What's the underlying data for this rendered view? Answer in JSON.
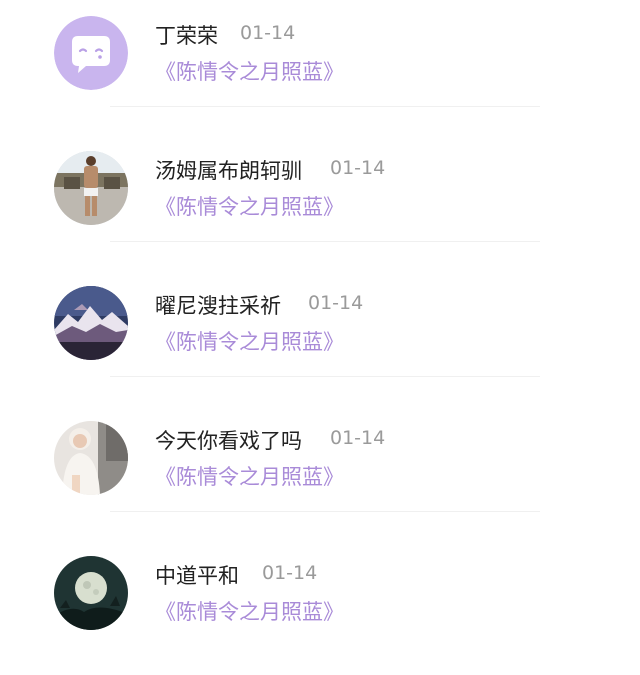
{
  "comments": [
    {
      "name": "丁荣荣",
      "date": "01-14",
      "title": "《陈情令之月照蓝》",
      "avatar": "purple-bubble-icon"
    },
    {
      "name": "汤姆属布朗轲驯",
      "date": "01-14",
      "title": "《陈情令之月照蓝》",
      "avatar": "person-photo"
    },
    {
      "name": "曜尼溲拄采祈",
      "date": "01-14",
      "title": "《陈情令之月照蓝》",
      "avatar": "mountain-photo"
    },
    {
      "name": "今天你看戏了吗",
      "date": "01-14",
      "title": "《陈情令之月照蓝》",
      "avatar": "girl-photo"
    },
    {
      "name": "中道平和",
      "date": "01-14",
      "title": "《陈情令之月照蓝》",
      "avatar": "moon-photo"
    }
  ],
  "colors": {
    "accent": "#a98bd8",
    "name_text": "#222222",
    "date_text": "#9a9a9a",
    "avatar_bubble_bg": "#c9b5ee"
  }
}
